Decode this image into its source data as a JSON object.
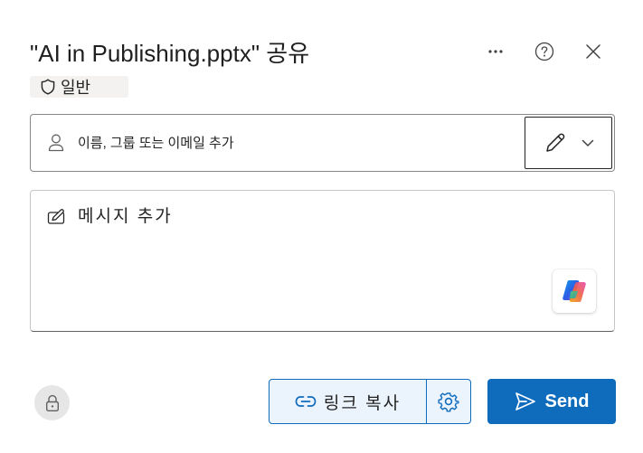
{
  "dialog": {
    "title": "\"AI in Publishing.pptx\" 공유"
  },
  "header": {
    "more_icon": "more-horizontal-icon",
    "help_icon": "question-circle-icon",
    "close_icon": "close-icon"
  },
  "sensitivity": {
    "label": "일반",
    "icon": "shield-icon"
  },
  "people_picker": {
    "placeholder": "이름, 그룹 또는 이메일 추가",
    "value": "",
    "icon": "person-icon",
    "permission_icon": "pencil-edit-icon",
    "dropdown_icon": "chevron-down-icon"
  },
  "message": {
    "placeholder": "메시지 추가",
    "value": "",
    "icon": "compose-icon",
    "copilot_icon": "copilot-icon"
  },
  "footer": {
    "lock_icon": "lock-icon",
    "copy_link_label": "링크 복사",
    "link_icon": "link-icon",
    "settings_icon": "gear-icon",
    "send_label": "Send",
    "send_icon": "send-icon"
  },
  "colors": {
    "primary": "#0f6cbd",
    "copy_link_bg": "#ebf3fc",
    "text": "#242424"
  }
}
